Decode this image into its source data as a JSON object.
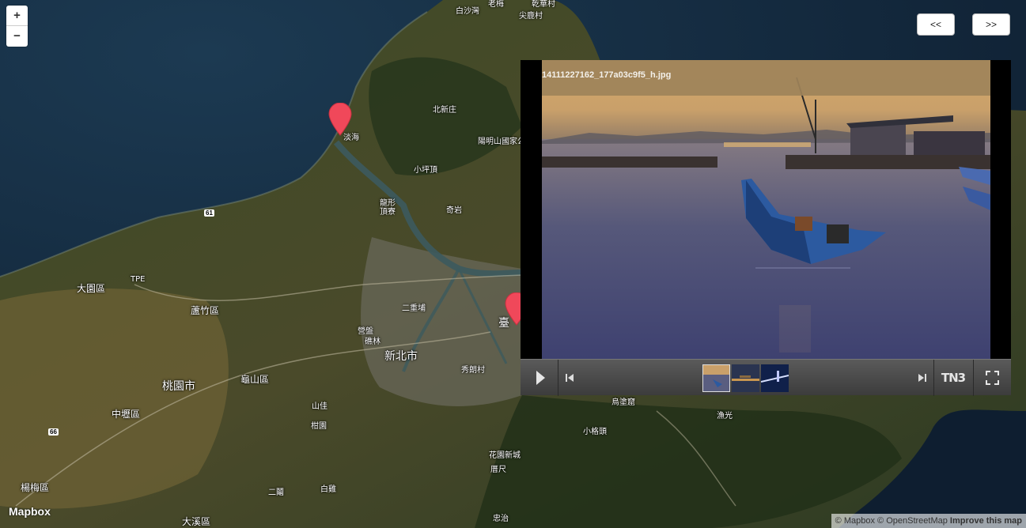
{
  "map": {
    "zoom_in": "+",
    "zoom_out": "−",
    "prev_label": "<<",
    "next_label": ">>",
    "logo": "Mapbox",
    "attribution": {
      "mapbox": "© Mapbox",
      "osm": "© OpenStreetMap",
      "improve": "Improve this map"
    },
    "places": {
      "baishawan": "白沙灣",
      "laomei": "老梅",
      "qianhua": "乾華村",
      "jianlu": "尖鹿村",
      "danhai": "淡海",
      "beixinzhuang": "北新庄",
      "yangmingshan": "陽明山國家公",
      "xiaopingding": "小坪頂",
      "longxing": "龍形",
      "dingliao": "頂寮",
      "qiyan": "奇岩",
      "tpe": "TPE",
      "dayuan": "大園區",
      "luzhu": "蘆竹區",
      "erchongpu": "二重埔",
      "yingpan": "營盤",
      "linlin": "礁林",
      "taipei": "臺",
      "xinbei": "新北市",
      "taoyuan": "桃園市",
      "guishan": "龜山區",
      "xiulang": "秀朗村",
      "zhongli": "中壢區",
      "shanjia": "山佳",
      "xiangcuo": "柑園",
      "yangmei": "楊梅區",
      "erlu": "二鬮",
      "bailu": "白雞",
      "daxi": "大溪區",
      "huayuan": "花園新城",
      "cuoche": "厝尺",
      "zhongzhi": "忠治",
      "wutuku": "烏塗窟",
      "yuguang": "漁光",
      "xiaogetou": "小格頭"
    },
    "roads": {
      "r61": "61",
      "r66": "66"
    }
  },
  "gallery": {
    "photo_title": "14111227162_177a03c9f5_h.jpg",
    "logo": "TN3",
    "thumbnails": [
      "harbor-dusk",
      "pier-lights",
      "bridge-night"
    ],
    "selected_thumbnail": 0
  }
}
